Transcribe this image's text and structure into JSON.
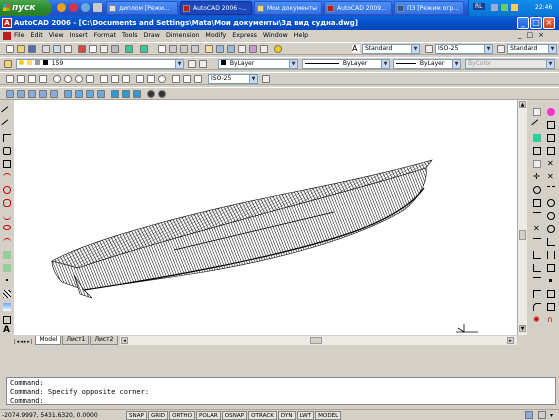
{
  "taskbar": {
    "start_label": "пуск",
    "tasks": [
      {
        "label": "диплом [Режи..."
      },
      {
        "label": "AutoCAD 2006 -..."
      },
      {
        "label": "Мои документы"
      },
      {
        "label": "AutoCAD 2009..."
      },
      {
        "label": "ПЗ [Режим огр..."
      }
    ],
    "tray": {
      "lang": "RL",
      "time": "22:46"
    }
  },
  "window": {
    "title": "AutoCAD 2006 - [C:\\Documents and Settings\\Mata\\Мои документы\\3д вид судна.dwg]",
    "icon_letter": "A"
  },
  "menu": [
    "File",
    "Edit",
    "View",
    "Insert",
    "Format",
    "Tools",
    "Draw",
    "Dimension",
    "Modify",
    "Express",
    "Window",
    "Help"
  ],
  "toolbar": {
    "text_style": "Standard",
    "dim_style": "ISO-25",
    "table_style": "Standard",
    "layer": "159",
    "color": "ByLayer",
    "linetype": "ByLayer",
    "lineweight": "ByLayer",
    "plotstyle": "ByColor",
    "dim_style2": "ISO-25"
  },
  "layout_tabs": [
    "Model",
    "Лист1",
    "Лист2"
  ],
  "command_line": [
    "Command:",
    "Command: Specify opposite corner:",
    "Command:"
  ],
  "status": {
    "coords": "-2074.9997, 5431.6320, 0.0000",
    "toggles": [
      "SNAP",
      "GRID",
      "ORTHO",
      "POLAR",
      "OSNAP",
      "OTRACK",
      "DYN",
      "LWT",
      "MODEL"
    ]
  },
  "colors": {
    "taskbar": "#245edb",
    "titlebar": "#0550c9",
    "start": "#2e8b2e",
    "canvas": "#ffffff"
  }
}
